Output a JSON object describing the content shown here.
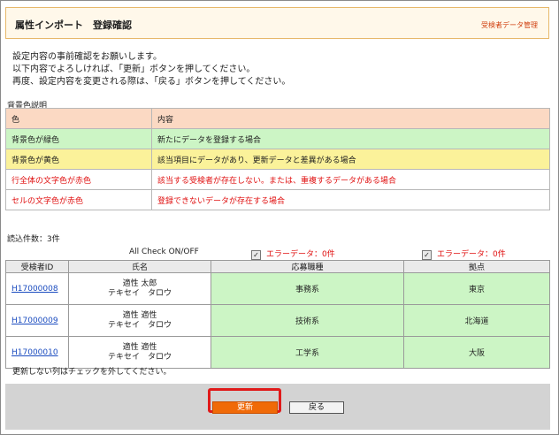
{
  "header": {
    "title": "属性インポート　登録確認",
    "link": "受検者データ管理"
  },
  "intro": [
    "設定内容の事前確認をお願いします。",
    "以下内容でよろしければ、「更新」ボタンを押してください。",
    "再度、設定内容を変更される際は、「戻る」ボタンを押してください。"
  ],
  "legend": {
    "label": "背景色説明",
    "header": {
      "col1": "色",
      "col2": "内容"
    },
    "rows": [
      {
        "c1": "背景色が緑色",
        "c2": "新たにデータを登録する場合"
      },
      {
        "c1": "背景色が黄色",
        "c2": "該当項目にデータがあり、更新データと差異がある場合"
      },
      {
        "c1": "行全体の文字色が赤色",
        "c2": "該当する受検者が存在しない。または、重複するデータがある場合"
      },
      {
        "c1": "セルの文字色が赤色",
        "c2": "登録できないデータが存在する場合"
      }
    ]
  },
  "count_label": "読込件数：3件",
  "checks": {
    "all_check": "All Check ON/OFF",
    "error1": "エラーデータ：0件",
    "error2": "エラーデータ：0件"
  },
  "table": {
    "headers": [
      "受検者ID",
      "氏名",
      "応募職種",
      "拠点"
    ],
    "rows": [
      {
        "id": "H17000008",
        "name1": "適性 太郎",
        "name2": "テキセイ　タロウ",
        "job": "事務系",
        "base": "東京"
      },
      {
        "id": "H17000009",
        "name1": "適性 適性",
        "name2": "テキセイ　タロウ",
        "job": "技術系",
        "base": "北海道"
      },
      {
        "id": "H17000010",
        "name1": "適性 適性",
        "name2": "テキセイ　タロウ",
        "job": "工学系",
        "base": "大阪"
      }
    ]
  },
  "note": "更新しない列はチェックを外してください。",
  "buttons": {
    "update": "更新",
    "back": "戻る"
  },
  "colors": {
    "accent": "#f06a08",
    "highlight": "#e01a1a",
    "green": "#ccf5c5",
    "yellow": "#fbf29a",
    "header": "#fbd9c3"
  }
}
